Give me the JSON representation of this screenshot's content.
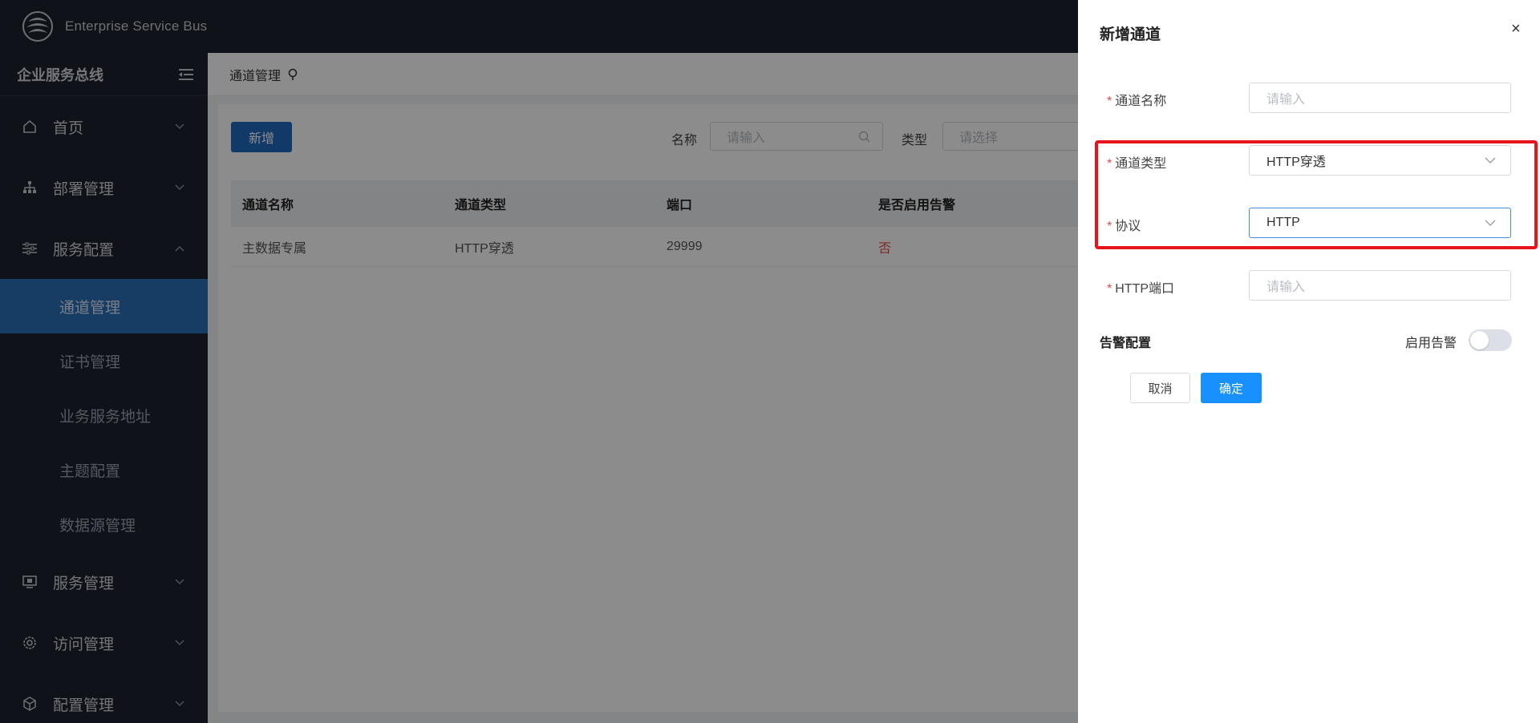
{
  "header": {
    "app_title": "Enterprise Service Bus"
  },
  "sidebar": {
    "title": "企业服务总线",
    "items": [
      {
        "label": "首页",
        "icon": "home-icon",
        "expanded": false
      },
      {
        "label": "部署管理",
        "icon": "sitemap-icon",
        "expanded": false
      },
      {
        "label": "服务配置",
        "icon": "sliders-icon",
        "expanded": true
      },
      {
        "label": "服务管理",
        "icon": "monitor-icon",
        "expanded": false
      },
      {
        "label": "访问管理",
        "icon": "gear-icon",
        "expanded": false
      },
      {
        "label": "配置管理",
        "icon": "cube-icon",
        "expanded": false
      }
    ],
    "sub_items": [
      {
        "label": "通道管理",
        "active": true
      },
      {
        "label": "证书管理",
        "active": false
      },
      {
        "label": "业务服务地址",
        "active": false
      },
      {
        "label": "主题配置",
        "active": false
      },
      {
        "label": "数据源管理",
        "active": false
      }
    ]
  },
  "breadcrumb": {
    "label": "通道管理"
  },
  "toolbar": {
    "add_label": "新增",
    "name_label": "名称",
    "name_placeholder": "请输入",
    "type_label": "类型",
    "type_placeholder": "请选择"
  },
  "table": {
    "columns": [
      "通道名称",
      "通道类型",
      "端口",
      "是否启用告警"
    ],
    "rows": [
      {
        "name": "主数据专属",
        "type": "HTTP穿透",
        "port": "29999",
        "alarm": "否"
      }
    ]
  },
  "drawer": {
    "title": "新增通道",
    "close": "×",
    "fields": {
      "name": {
        "label": "通道名称",
        "placeholder": "请输入"
      },
      "type": {
        "label": "通道类型",
        "value": "HTTP穿透"
      },
      "protocol": {
        "label": "协议",
        "value": "HTTP"
      },
      "http_port": {
        "label": "HTTP端口",
        "placeholder": "请输入"
      }
    },
    "required_mark": "*",
    "alarm_section": "告警配置",
    "alarm_toggle_label": "启用告警",
    "alarm_enabled": false,
    "cancel_label": "取消",
    "ok_label": "确定"
  },
  "colors": {
    "sidebar_bg": "#1d222c",
    "active_menu": "#2c6fb7",
    "primary": "#1890ff",
    "highlight_border": "#e8141c",
    "danger_text": "#e04b4b"
  }
}
